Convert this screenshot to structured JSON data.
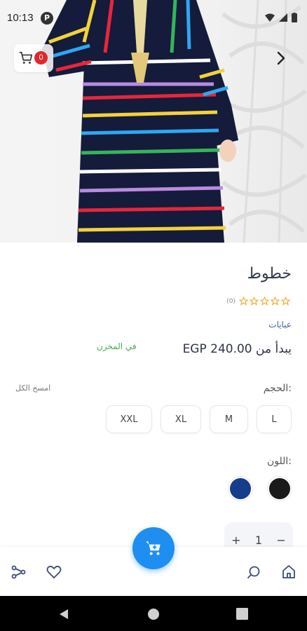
{
  "status_bar": {
    "time": "10:13",
    "notification_letter": "P"
  },
  "header": {
    "cart_count": "0"
  },
  "product": {
    "title": "خطوط",
    "rating_count": "(0)",
    "rating_stars": 0,
    "category": "عبايات",
    "price": "يبدأ من EGP 240.00",
    "stock_status": "في المخزن"
  },
  "size": {
    "label": "الحجم:",
    "clear_all": "امسح الكل",
    "options": [
      "L",
      "M",
      "XL",
      "XXL"
    ]
  },
  "color": {
    "label": "اللون:",
    "options": [
      "#1a1a1a",
      "#163c8c"
    ]
  },
  "quantity": {
    "minus": "−",
    "value": "1",
    "plus": "+"
  },
  "bottom_nav": {
    "icons": [
      "home-icon",
      "search-icon",
      "cart-icon",
      "heart-icon",
      "share-icon"
    ]
  },
  "colors": {
    "accent": "#1f8ef1",
    "badge": "#e2262c",
    "stock": "#3fb14a",
    "title": "#333a55",
    "star": "#f5a623"
  }
}
